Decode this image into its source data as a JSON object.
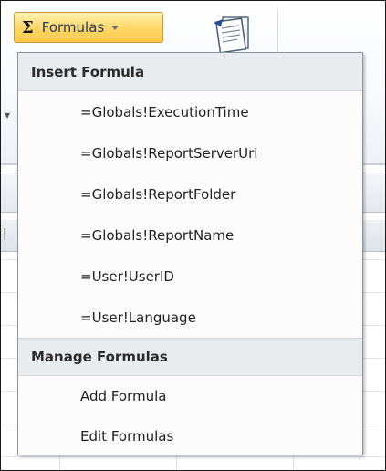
{
  "ribbon": {
    "formulas_button": {
      "symbol": "Σ",
      "label": "Formulas"
    }
  },
  "menu": {
    "insert_section": {
      "header": "Insert Formula",
      "items": [
        "=Globals!ExecutionTime",
        "=Globals!ReportServerUrl",
        "=Globals!ReportFolder",
        "=Globals!ReportName",
        "=User!UserID",
        "=User!Language"
      ]
    },
    "manage_section": {
      "header": "Manage Formulas",
      "items": [
        "Add Formula",
        "Edit Formulas"
      ]
    }
  },
  "icons": {
    "formulas_caret": "chevron-down-icon",
    "report_document": "document-icon"
  },
  "colors": {
    "button_gradient_top": "#fff2b3",
    "button_gradient_bottom": "#fdc944",
    "button_border": "#c79b3a",
    "menu_header_bg": "#e9ecef",
    "menu_border": "#8f959c"
  }
}
